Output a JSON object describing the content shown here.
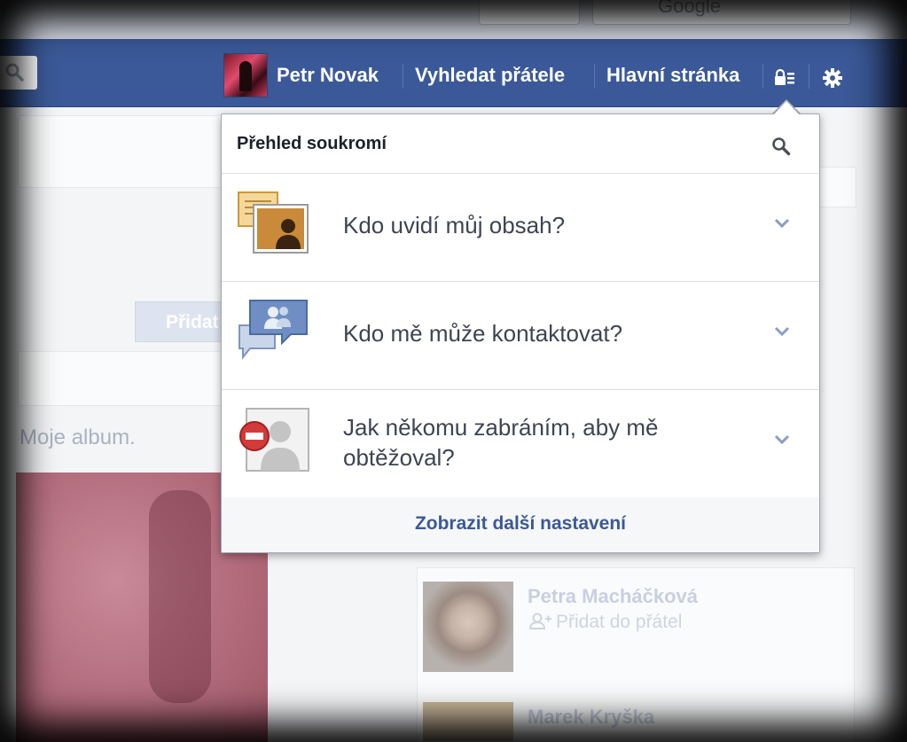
{
  "nav": {
    "user_name": "Petr Novak",
    "find_friends": "Vyhledat přátele",
    "home": "Hlavní stránka",
    "browser_search_label": "Google"
  },
  "background": {
    "add_button": "Přidat",
    "album_text": "Moje album.",
    "people": [
      {
        "name": "Petra Macháčková",
        "action": "Přidat do přátel"
      },
      {
        "name": "Marek Kryška"
      }
    ]
  },
  "privacy_menu": {
    "title": "Přehled soukromí",
    "items": [
      {
        "label": "Kdo uvidí můj obsah?",
        "icon": "content-visibility-icon"
      },
      {
        "label": "Kdo mě může kontaktovat?",
        "icon": "contact-icon"
      },
      {
        "label": "Jak někomu zabráním, aby mě obtěžoval?",
        "icon": "block-user-icon"
      }
    ],
    "more_settings": "Zobrazit další nastavení"
  },
  "colors": {
    "brand": "#3b5998",
    "link": "#3b5998",
    "block_red": "#d33a3a"
  }
}
